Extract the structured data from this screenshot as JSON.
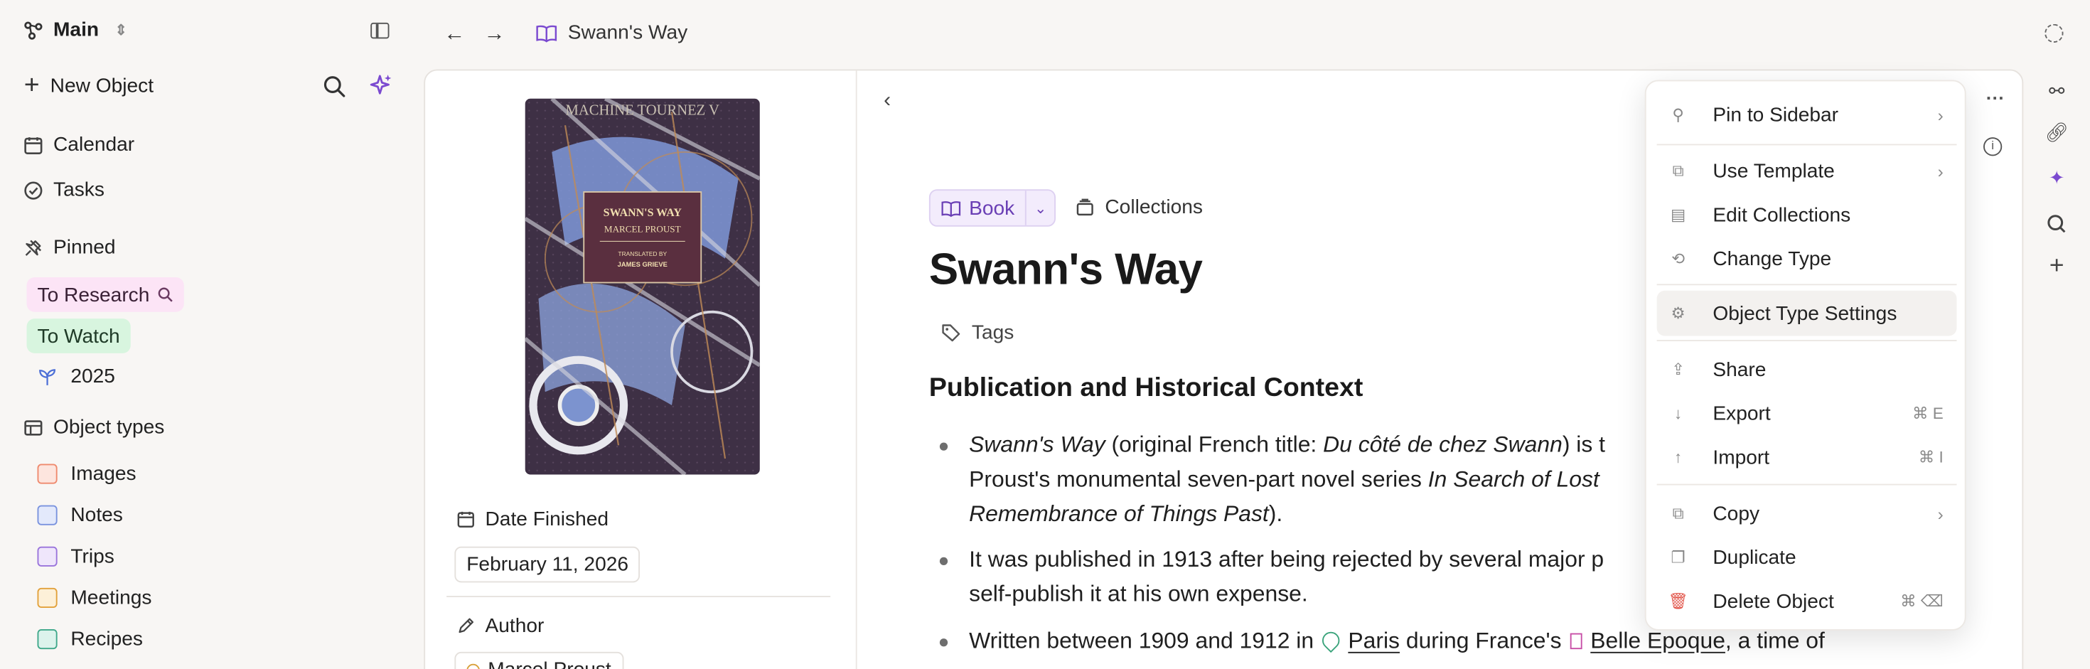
{
  "sidebar": {
    "workspace": "Main",
    "new_object": "New Object",
    "calendar": "Calendar",
    "tasks": "Tasks",
    "pinned_heading": "Pinned",
    "pinned": [
      "To Research",
      "To Watch",
      "2025"
    ],
    "object_types_heading": "Object types",
    "object_types": [
      "Images",
      "Notes",
      "Trips",
      "Meetings",
      "Recipes"
    ]
  },
  "header": {
    "breadcrumb": "Swann's Way"
  },
  "object": {
    "type_label": "Book",
    "collections_label": "Collections",
    "title": "Swann's Way",
    "tags_label": "Tags",
    "cover": {
      "top_text": "MACHINE TOURNEZ V",
      "book_title": "SWANN'S WAY",
      "author": "MARCEL PROUST",
      "translated_by": "TRANSLATED BY",
      "translator": "JAMES GRIEVE"
    },
    "date_finished_label": "Date Finished",
    "date_finished": "February 11, 2026",
    "author_label": "Author",
    "author_value": "Marcel Proust"
  },
  "content": {
    "heading": "Publication and Historical Context",
    "bullet1": {
      "a": "Swann's Way",
      "b": " (original French title: ",
      "c": "Du côté de chez Swann",
      "d": ") is t",
      "e": "Proust's monumental seven-part novel series ",
      "f": "In Search of Lost",
      "g": "Remembrance of Things Past",
      "h": ")."
    },
    "bullet2": {
      "a": "It was published in 1913 after being rejected by several major p",
      "b": "self-publish it at his own expense."
    },
    "bullet3": {
      "a": "Written between 1909 and 1912 in ",
      "b": "Paris",
      "c": " during France's ",
      "d": "Belle Epoque",
      "e": ", a time of"
    }
  },
  "menu": {
    "items": [
      {
        "label": "Pin to Sidebar",
        "icon": "pin-icon",
        "submenu": true
      },
      {
        "label": "Use Template",
        "icon": "template-icon",
        "submenu": true
      },
      {
        "label": "Edit Collections",
        "icon": "collections-icon"
      },
      {
        "label": "Change Type",
        "icon": "change-type-icon"
      },
      {
        "label": "Object Type Settings",
        "icon": "gear-icon"
      },
      {
        "label": "Share",
        "icon": "share-icon"
      },
      {
        "label": "Export",
        "icon": "export-icon",
        "shortcut": "⌘ E"
      },
      {
        "label": "Import",
        "icon": "import-icon",
        "shortcut": "⌘ I"
      },
      {
        "label": "Copy",
        "icon": "copy-icon",
        "submenu": true
      },
      {
        "label": "Duplicate",
        "icon": "duplicate-icon"
      },
      {
        "label": "Delete Object",
        "icon": "trash-icon",
        "shortcut": "⌘ ⌫"
      }
    ]
  },
  "colors": {
    "accent_purple": "#7b4ad0",
    "pinned_research_bg": "#fce4f6",
    "pinned_watch_bg": "#d8f5df",
    "danger": "#e2574c"
  }
}
